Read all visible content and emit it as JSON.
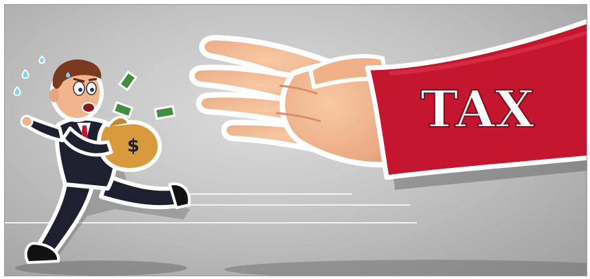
{
  "illustration": {
    "sleeve_text": "TAX",
    "bag_symbol": "$",
    "colors": {
      "background": "#c4c4c4",
      "sleeve": "#c4162e",
      "skin": "#f2b48c",
      "bag": "#d89a3c",
      "suit": "#1e2030",
      "money": "#3f8f3f"
    }
  }
}
